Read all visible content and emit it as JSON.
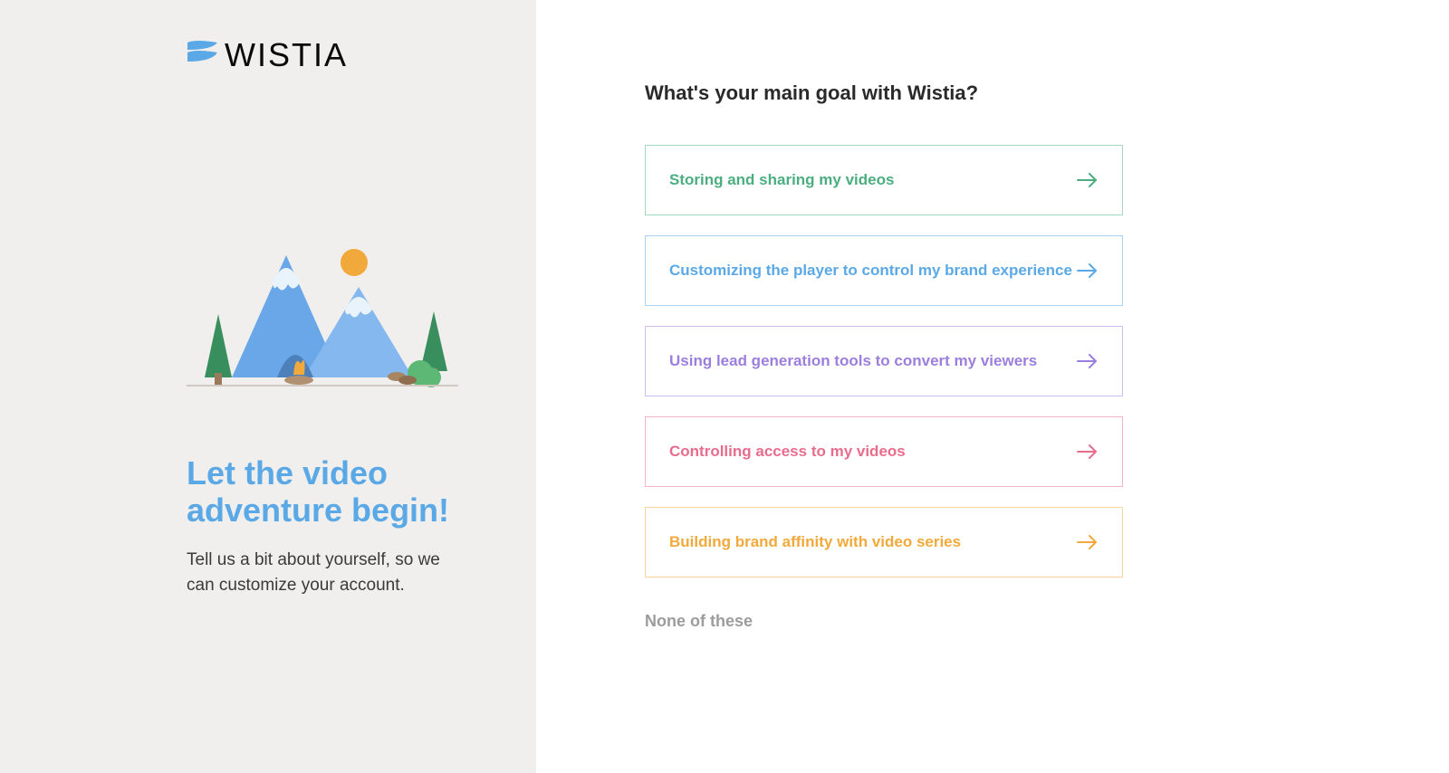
{
  "brand": {
    "name": "WISTIA"
  },
  "left": {
    "heading": "Let the video adventure begin!",
    "subtext": "Tell us a bit about yourself, so we can customize your account."
  },
  "right": {
    "question": "What's your main goal with Wistia?",
    "options": [
      {
        "label": "Storing and sharing my videos",
        "color": "#4cae7f"
      },
      {
        "label": "Customizing the player to control my brand experience",
        "color": "#5aa9e6"
      },
      {
        "label": "Using lead generation tools to convert my viewers",
        "color": "#9b7ede"
      },
      {
        "label": "Controlling access to my videos",
        "color": "#e86c8c"
      },
      {
        "label": "Building brand affinity with video series",
        "color": "#f2a93b"
      }
    ],
    "none_label": "None of these"
  },
  "colors": {
    "left_bg": "#f1efed",
    "heading_blue": "#5aa9e6",
    "text_dark": "#2a2a2a",
    "text_gray": "#9c9c9c"
  }
}
